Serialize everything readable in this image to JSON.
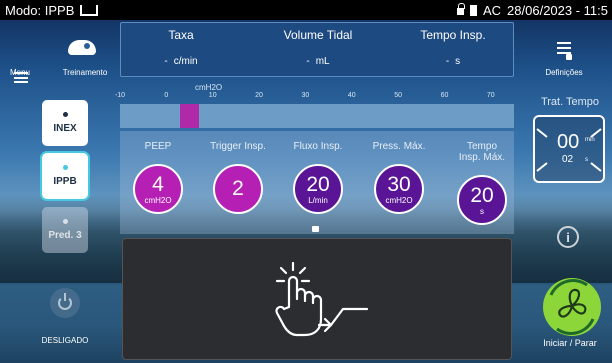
{
  "status_bar": {
    "mode": "Modo: IPPB",
    "power_source": "AC",
    "datetime": "28/06/2023 - 11:5"
  },
  "left_sidebar": {
    "menu_label": "Menu",
    "training_label": "Treinamento",
    "modes": [
      {
        "label": "INEX",
        "state": "normal"
      },
      {
        "label": "IPPB",
        "state": "selected"
      },
      {
        "label": "Pred. 3",
        "state": "disabled"
      }
    ],
    "power_label": "DESLIGADO"
  },
  "readouts": [
    {
      "label": "Taxa",
      "value": "-",
      "unit": "c/min"
    },
    {
      "label": "Volume Tidal",
      "value": "-",
      "unit": "mL"
    },
    {
      "label": "Tempo Insp.",
      "value": "-",
      "unit": "s"
    }
  ],
  "pressure_scale": {
    "unit": "cmH2O",
    "ticks": [
      "-10",
      "0",
      "10",
      "20",
      "30",
      "40",
      "50",
      "60",
      "70"
    ],
    "min": -10,
    "max": 75,
    "fill_from": 3,
    "fill_to": 7
  },
  "parameters": [
    {
      "label": "PEEP",
      "value": "4",
      "unit": "cmH2O",
      "color": "#b61fb3"
    },
    {
      "label": "Trigger Insp.",
      "value": "2",
      "unit": "",
      "color": "#b61fb3"
    },
    {
      "label": "Fluxo Insp.",
      "value": "20",
      "unit": "L/min",
      "color": "#5a1596"
    },
    {
      "label": "Press. Máx.",
      "value": "30",
      "unit": "cmH2O",
      "color": "#5a1596"
    },
    {
      "label": "Tempo Insp. Máx.",
      "value": "20",
      "unit": "s",
      "color": "#5a1596"
    }
  ],
  "right_sidebar": {
    "settings_label": "Definições",
    "timer_title": "Trat. Tempo",
    "timer_minutes": "00",
    "timer_min_unit": "min",
    "timer_seconds": "02",
    "timer_sec_unit": "s",
    "start_stop_label": "Iniciar / Parar"
  },
  "colors": {
    "accent_magenta": "#b61fb3",
    "accent_purple": "#5a1596",
    "start_button_green": "#8dd63a"
  }
}
